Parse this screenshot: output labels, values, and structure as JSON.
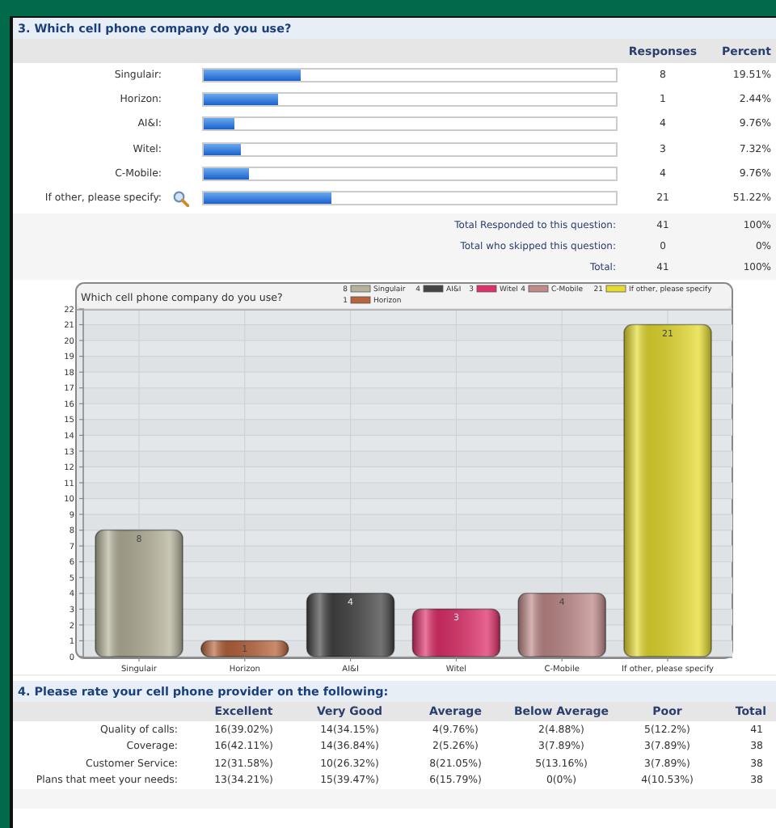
{
  "question_3": {
    "title": "3. Which cell phone company do you use?",
    "columns": [
      "Responses",
      "Percent"
    ],
    "rows": [
      {
        "label": "Singulair:",
        "search_icon": false,
        "level": 0.237,
        "responses": "8",
        "percent": "19.51%"
      },
      {
        "label": "Horizon:",
        "search_icon": false,
        "level": 0.18,
        "responses": "1",
        "percent": "2.44%"
      },
      {
        "label": "AI&I:",
        "search_icon": false,
        "level": 0.074,
        "responses": "4",
        "percent": "9.76%"
      },
      {
        "label": "Witel:",
        "search_icon": false,
        "level": 0.09,
        "responses": "3",
        "percent": "7.32%"
      },
      {
        "label": "C-Mobile:",
        "search_icon": false,
        "level": 0.11,
        "responses": "4",
        "percent": "9.76%"
      },
      {
        "label": "If other, please specify:",
        "search_icon": true,
        "level": 0.31,
        "responses": "21",
        "percent": "51.22%"
      }
    ],
    "totals": [
      {
        "label": "Total Responded to this question:",
        "responses": "41",
        "percent": "100%"
      },
      {
        "label": "Total who skipped this question:",
        "responses": "0",
        "percent": "0%"
      },
      {
        "label": "Total:",
        "responses": "41",
        "percent": "100%"
      }
    ],
    "chart": {
      "legend": [
        {
          "count": "8",
          "label": "Singulair",
          "color": "#b5b29a"
        },
        {
          "count": "1",
          "label": "Horizon",
          "color": "#b8643c"
        },
        {
          "count": "4",
          "label": "AI&I",
          "color": "#444444"
        },
        {
          "count": "3",
          "label": "Witel",
          "color": "#e0306a"
        },
        {
          "count": "4",
          "label": "C-Mobile",
          "color": "#c08a8a"
        },
        {
          "count": "21",
          "label": "If other, please specify",
          "color": "#e6dc30"
        }
      ],
      "chart_data": {
        "type": "bar",
        "title": "Which cell phone company do you use?",
        "categories": [
          "Singulair",
          "Horizon",
          "AI&I",
          "Witel",
          "C-Mobile",
          "If other, please specify"
        ],
        "values": [
          8,
          1,
          4,
          3,
          4,
          21
        ],
        "ylim": [
          0,
          22
        ],
        "yticks": [
          0,
          1,
          2,
          3,
          4,
          5,
          6,
          7,
          8,
          9,
          10,
          11,
          12,
          13,
          14,
          15,
          16,
          17,
          18,
          19,
          20,
          21,
          22
        ],
        "data_labels": true,
        "grid": true
      }
    }
  },
  "question_4": {
    "title": "4. Please rate your cell phone provider on the following:",
    "columns": [
      "Excellent",
      "Very Good",
      "Average",
      "Below Average",
      "Poor",
      "Total"
    ],
    "rows": [
      {
        "label": "Quality of calls:",
        "cells": [
          "16(39.02%)",
          "14(34.15%)",
          "4(9.76%)",
          "2(4.88%)",
          "5(12.2%)",
          "41"
        ]
      },
      {
        "label": "Coverage:",
        "cells": [
          "16(42.11%)",
          "14(36.84%)",
          "2(5.26%)",
          "3(7.89%)",
          "3(7.89%)",
          "38"
        ]
      },
      {
        "label": "Customer Service:",
        "cells": [
          "12(31.58%)",
          "10(26.32%)",
          "8(21.05%)",
          "5(13.16%)",
          "3(7.89%)",
          "38"
        ]
      },
      {
        "label": "Plans that meet your needs:",
        "cells": [
          "13(34.21%)",
          "15(39.47%)",
          "6(15.79%)",
          "0(0%)",
          "4(10.53%)",
          "38"
        ]
      }
    ]
  }
}
